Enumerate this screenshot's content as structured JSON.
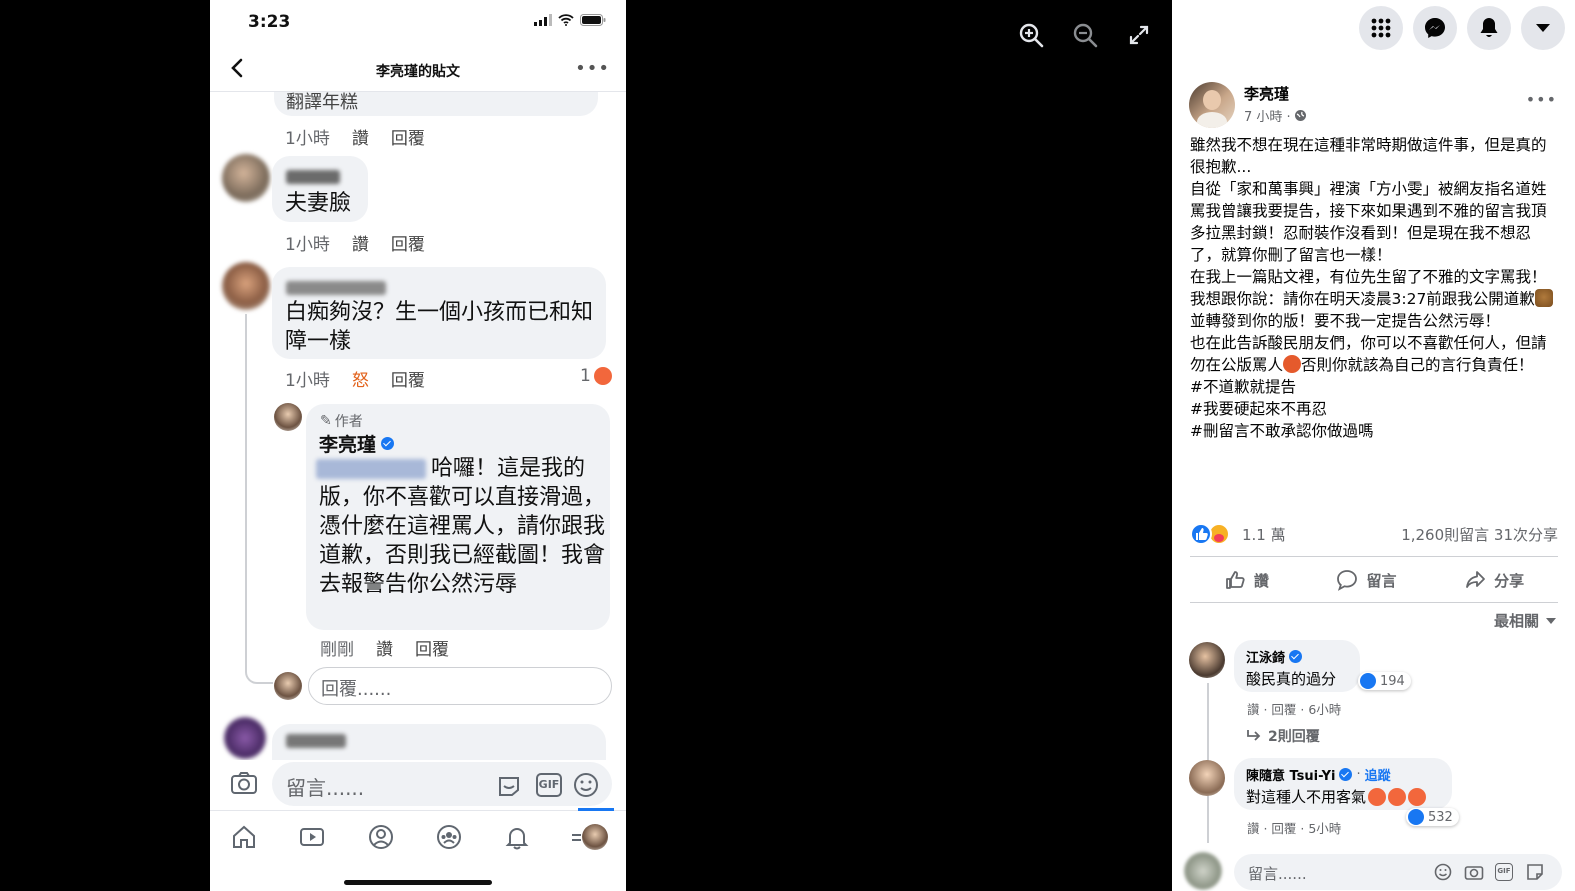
{
  "phone": {
    "status_time": "3:23",
    "header_title": "李亮瑾的貼文",
    "thread": {
      "top_partial_text": "翻譯年糕",
      "top_meta": {
        "time": "1小時",
        "like": "讚",
        "reply": "回覆"
      },
      "comment1": {
        "text": "夫妻臉",
        "time": "1小時",
        "like": "讚",
        "reply": "回覆"
      },
      "comment2": {
        "text": "白痴夠沒？生一個小孩而已和知障一樣",
        "time": "1小時",
        "reaction_label": "怒",
        "reply": "回覆",
        "reaction_count": "1"
      },
      "author_reply": {
        "badge": "作者",
        "name": "李亮瑾",
        "text": "哈囉！這是我的版，你不喜歡可以直接滑過，憑什麼在這裡罵人，請你跟我道歉，否則我已經截圖！我會去報警告你公然污辱",
        "time": "剛剛",
        "like": "讚",
        "reply": "回覆"
      },
      "reply_input_placeholder": "回覆......"
    },
    "compose_placeholder": "留言......",
    "gif_label": "GIF"
  },
  "sidebar": {
    "author": {
      "name": "李亮瑾",
      "time": "7 小時 · "
    },
    "post_paragraphs": [
      "雖然我不想在現在這種非常時期做這件事，但是真的很抱歉...",
      "自從「家和萬事興」裡演「方小雯」被網友指名道姓罵我曾讓我要提告，接下來如果遇到不雅的留言我頂多拉黑封鎖！忍耐裝作沒看到！但是現在我不想忍了，就算你刪了留言也一樣！",
      "在我上一篇貼文裡，有位先生留了不雅的文字罵我！我想跟你說：請你在明天凌晨3:27前跟我公開道歉",
      "並轉發到你的版！要不我一定提告公然污辱！",
      "也在此告訴酸民朋友們，你可以不喜歡任何人，但請勿在公版罵人",
      "否則你就該為自己的言行負責任！",
      "#不道歉就提告",
      "#我要硬起來不再忍",
      "#刪留言不敢承認你做過嗎"
    ],
    "reaction_count": "1.1 萬",
    "stats": "1,260則留言  31次分享",
    "actions": {
      "like": "讚",
      "comment": "留言",
      "share": "分享"
    },
    "sort": "最相關",
    "comments": [
      {
        "name": "江泳錡",
        "text": "酸民真的過分",
        "likes": "194",
        "meta": "讚 · 回覆 · 6小時",
        "replies": "2則回覆"
      },
      {
        "name": "陳隨意 Tsui-Yi",
        "follow": "追蹤",
        "text": "對這種人不用客氣",
        "likes": "532",
        "meta": "讚 · 回覆 · 5小時"
      }
    ],
    "compose_placeholder": "留言......",
    "gif_label": "GIF"
  },
  "colors": {
    "fb_blue": "#1877f2",
    "angry": "#e2621b",
    "bubble": "#f0f2f5"
  }
}
